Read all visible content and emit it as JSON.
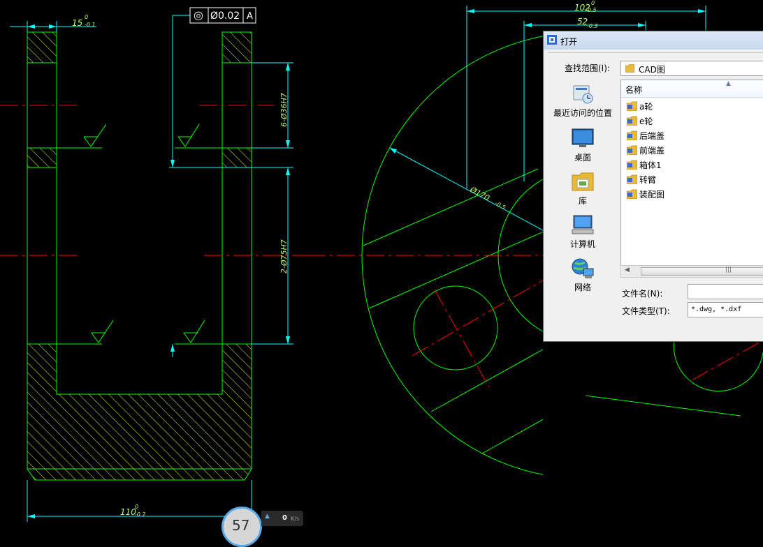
{
  "drawing": {
    "left_view": {
      "dim_top": "15",
      "dim_top_tol": "0",
      "dim_top_tol2": "-0.1",
      "dim_bottom": "110",
      "dim_bottom_tol": "0",
      "dim_bottom_tol2": "-0.2",
      "dim_hole_upper": "6-Ø36H7",
      "dim_hole_lower": "2-Ø75H7",
      "tolerance_frame": {
        "symbol": "◎",
        "value": "Ø0.02",
        "datum": "A"
      }
    },
    "right_view": {
      "dim_width": "102",
      "dim_width_tol": "0",
      "dim_width_tol2": "-0.5",
      "dim_partial": "52",
      "dim_partial_tol": "-0.3",
      "dim_diameter": "Ø170",
      "dim_diameter_tol": "-0.5"
    }
  },
  "dialog": {
    "title": "打开",
    "lookin_label": "查找范围(I):",
    "lookin_value": "CAD图",
    "places": [
      {
        "label": "最近访问的位置",
        "icon": "recent-places-icon"
      },
      {
        "label": "桌面",
        "icon": "desktop-icon"
      },
      {
        "label": "库",
        "icon": "library-icon"
      },
      {
        "label": "计算机",
        "icon": "computer-icon"
      },
      {
        "label": "网络",
        "icon": "network-icon"
      }
    ],
    "column_name": "名称",
    "files": [
      "a轮",
      "e轮",
      "后端盖",
      "前端盖",
      "箱体1",
      "转臂",
      "装配图"
    ],
    "filename_label": "文件名(N):",
    "filename_value": "",
    "filetype_label": "文件类型(T):",
    "filetype_value": "*.dwg, *.dxf"
  },
  "widget": {
    "gauge_value": "57",
    "speed_value": "0",
    "speed_unit": "K/s"
  },
  "colors": {
    "outline": "#00ff00",
    "centerline": "#ff0000",
    "dimension": "#00ffff",
    "hatch": "#e6ff33"
  }
}
